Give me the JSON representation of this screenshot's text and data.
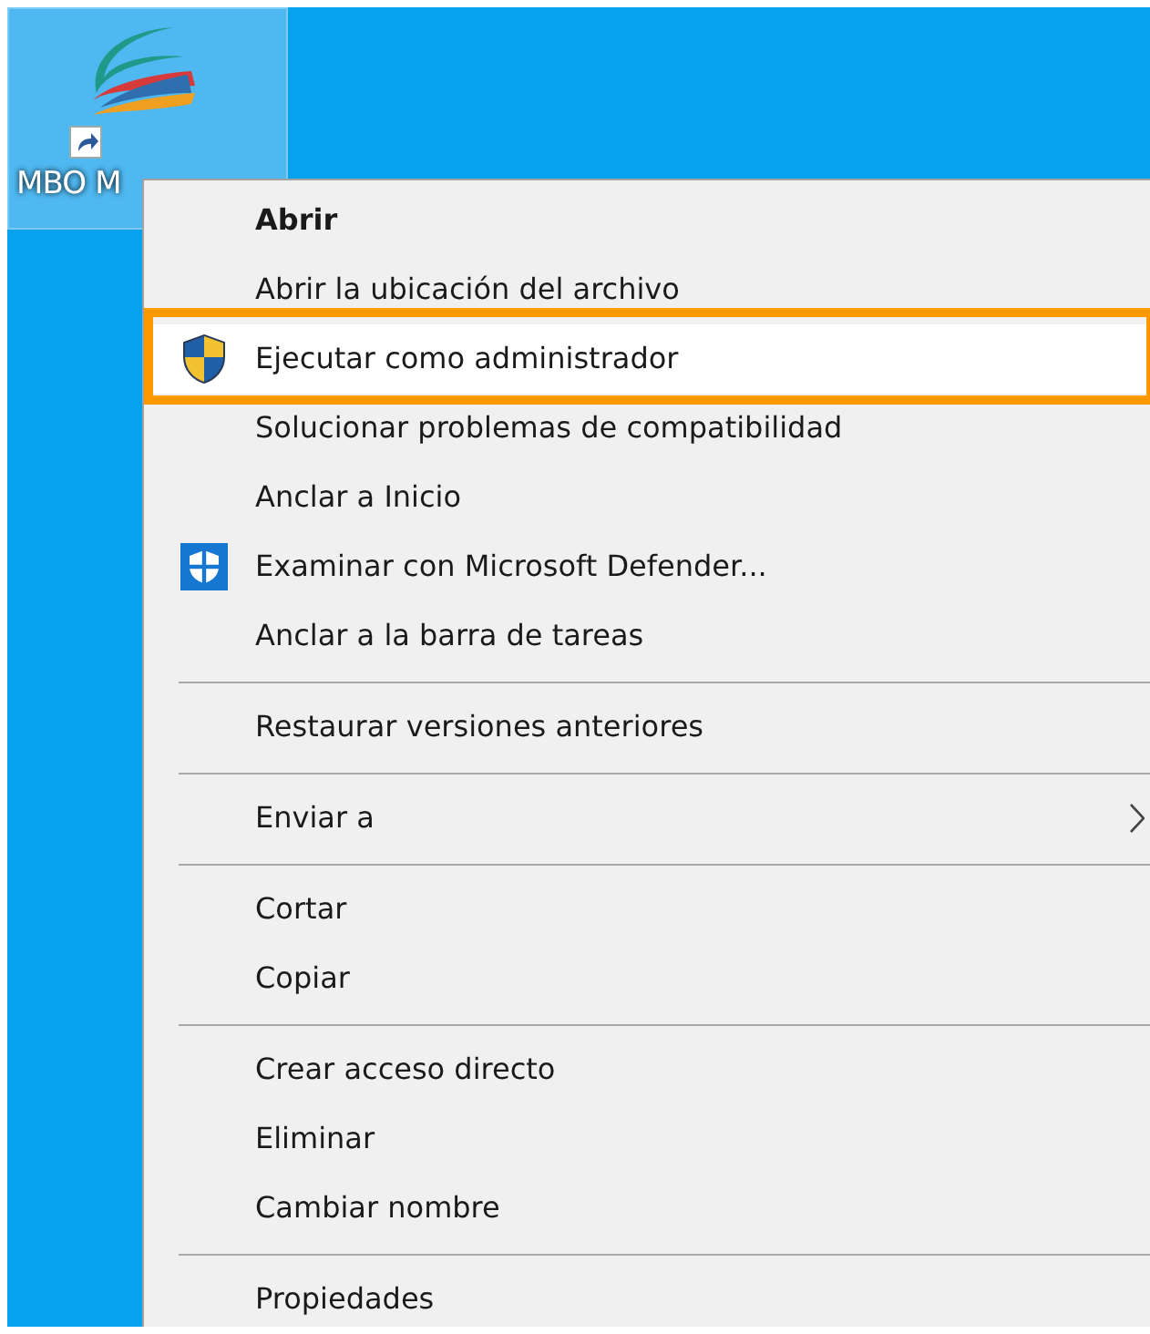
{
  "desktop_icon": {
    "label": "MBO M",
    "selected": true
  },
  "context_menu": {
    "items": [
      {
        "kind": "default",
        "label": "Abrir",
        "highlighted": false
      },
      {
        "kind": "item",
        "label": "Abrir la ubicación del archivo",
        "highlighted": false
      },
      {
        "kind": "shield",
        "label": "Ejecutar como administrador",
        "highlighted": true
      },
      {
        "kind": "item",
        "label": "Solucionar problemas de compatibilidad",
        "highlighted": false
      },
      {
        "kind": "item",
        "label": "Anclar a Inicio",
        "highlighted": false
      },
      {
        "kind": "defender",
        "label": "Examinar con Microsoft Defender...",
        "highlighted": false
      },
      {
        "kind": "item",
        "label": "Anclar a la barra de tareas",
        "highlighted": false
      },
      {
        "kind": "separator"
      },
      {
        "kind": "item",
        "label": "Restaurar versiones anteriores",
        "highlighted": false
      },
      {
        "kind": "separator"
      },
      {
        "kind": "submenu",
        "label": "Enviar a",
        "highlighted": false
      },
      {
        "kind": "separator"
      },
      {
        "kind": "item",
        "label": "Cortar",
        "highlighted": false
      },
      {
        "kind": "item",
        "label": "Copiar",
        "highlighted": false
      },
      {
        "kind": "separator"
      },
      {
        "kind": "item",
        "label": "Crear acceso directo",
        "highlighted": false
      },
      {
        "kind": "item",
        "label": "Eliminar",
        "highlighted": false
      },
      {
        "kind": "item",
        "label": "Cambiar nombre",
        "highlighted": false
      },
      {
        "kind": "separator"
      },
      {
        "kind": "item",
        "label": "Propiedades",
        "highlighted": false
      }
    ]
  }
}
